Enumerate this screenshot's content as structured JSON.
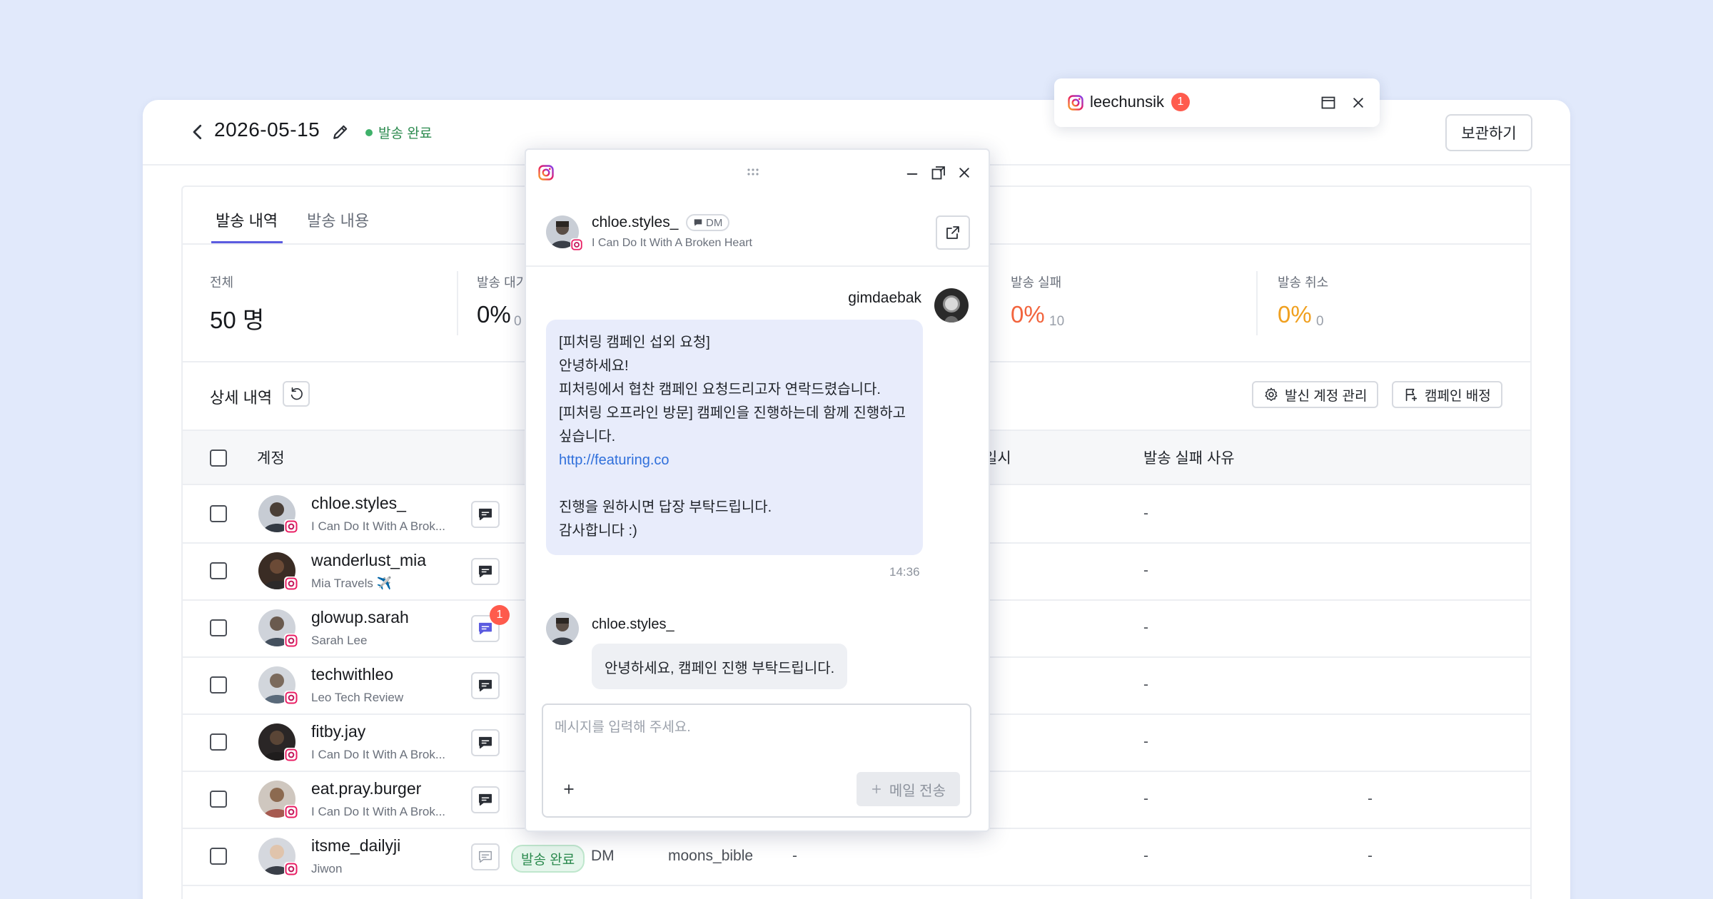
{
  "header": {
    "date": "2026-05-15",
    "status": "발송 완료",
    "save_label": "보관하기"
  },
  "tabs": [
    {
      "label": "발송 내역",
      "active": true
    },
    {
      "label": "발송 내용",
      "active": false
    }
  ],
  "stats": [
    {
      "label": "전체",
      "value": "50 명",
      "sub": ""
    },
    {
      "label": "발송 대기",
      "value": "0%",
      "sub": "0"
    },
    {
      "label": "발송 실패",
      "value": "0%",
      "sub": "10"
    },
    {
      "label": "발송 취소",
      "value": "0%",
      "sub": "0"
    }
  ],
  "detail": {
    "title": "상세 내역",
    "manage_accounts": "발신 계정 관리",
    "assign_campaign": "캠페인 배정"
  },
  "table": {
    "columns": [
      "계정",
      "일시",
      "발송 실패 사유"
    ],
    "rows": [
      {
        "name": "chloe.styles_",
        "sub": "I Can Do It With A Brok...",
        "dash1": "-",
        "dash2": ""
      },
      {
        "name": "wanderlust_mia",
        "sub": "Mia Travels ✈️",
        "dash1": "-",
        "dash2": ""
      },
      {
        "name": "glowup.sarah",
        "sub": "Sarah Lee",
        "dash1": "-",
        "dash2": "",
        "unread": "1"
      },
      {
        "name": "techwithleo",
        "sub": "Leo Tech Review",
        "dash1": "-",
        "dash2": ""
      },
      {
        "name": "fitby.jay",
        "sub": "I Can Do It With A Brok...",
        "dash1": "-",
        "dash2": ""
      },
      {
        "name": "eat.pray.burger",
        "sub": "I Can Do It With A Brok...",
        "dash1": "-",
        "dash2": "-"
      },
      {
        "name": "itsme_dailyji",
        "sub": "Jiwon",
        "status": "발송 완료",
        "type": "DM",
        "sender": "moons_bible",
        "dash0": "-",
        "dash1": "-",
        "dash2": "-"
      }
    ]
  },
  "mini_window": {
    "username": "leechunsik",
    "badge": "1"
  },
  "chat": {
    "username": "chloe.styles_",
    "tag": "DM",
    "subtitle": "I Can Do It With A Broken Heart",
    "sender": "gimdaebak",
    "message_lines": [
      "[피처링 캠페인 섭외 요청]",
      "안녕하세요!",
      "피처링에서 협찬 캠페인 요청드리고자 연락드렸습니다.",
      "[피처링 오프라인 방문] 캠페인을 진행하는데 함께 진행하고",
      "싶습니다.",
      "http://featuring.co",
      "",
      "진행을 원하시면 답장 부탁드립니다.",
      "감사합니다 :)"
    ],
    "time": "14:36",
    "reply_user": "chloe.styles_",
    "reply_text": "안녕하세요, 캠페인 진행 부탁드립니다.",
    "input_placeholder": "메시지를 입력해 주세요.",
    "send_label": "메일 전송"
  },
  "colors": {
    "accent": "#5b5be0",
    "success": "#2b8a4e",
    "fail": "#f2643d",
    "cancel": "#f0a020",
    "link": "#2f6fdb",
    "bubble": "#e8ecfb"
  }
}
